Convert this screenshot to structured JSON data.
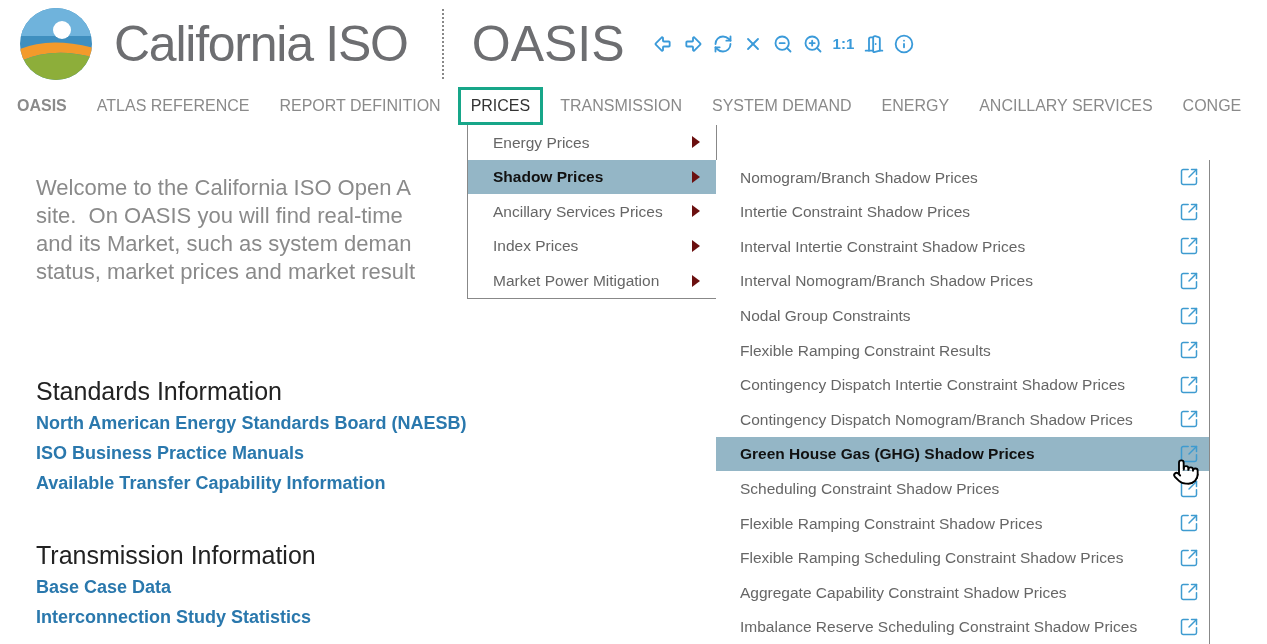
{
  "header": {
    "logo_text": "California ISO",
    "app_title": "OASIS",
    "toolbar": [
      {
        "kind": "back"
      },
      {
        "kind": "forward"
      },
      {
        "kind": "refresh"
      },
      {
        "kind": "close"
      },
      {
        "kind": "zoom_out"
      },
      {
        "kind": "zoom_in"
      },
      {
        "kind": "text",
        "label": "1:1"
      },
      {
        "kind": "exit"
      },
      {
        "kind": "info"
      }
    ]
  },
  "nav": [
    {
      "label": "OASIS",
      "selected": false,
      "bold": true
    },
    {
      "label": "ATLAS REFERENCE",
      "selected": false,
      "bold": false
    },
    {
      "label": "REPORT DEFINITION",
      "selected": false,
      "bold": false
    },
    {
      "label": "PRICES",
      "selected": true,
      "bold": false
    },
    {
      "label": "TRANSMISSION",
      "selected": false,
      "bold": false
    },
    {
      "label": "SYSTEM DEMAND",
      "selected": false,
      "bold": false
    },
    {
      "label": "ENERGY",
      "selected": false,
      "bold": false
    },
    {
      "label": "ANCILLARY SERVICES",
      "selected": false,
      "bold": false
    },
    {
      "label": "CONGE",
      "selected": false,
      "bold": false
    }
  ],
  "welcome_lines": [
    "Welcome to the California ISO Open A",
    "site.  On OASIS you will find real-time",
    "and its Market, such as system deman",
    "status, market prices and market result"
  ],
  "sections": [
    {
      "heading": "Standards Information",
      "links": [
        "North American Energy Standards Board (NAESB)",
        "ISO Business Practice Manuals",
        "Available Transfer Capability Information"
      ]
    },
    {
      "heading": "Transmission Information",
      "links": [
        "Base Case Data",
        "Interconnection Study Statistics"
      ]
    }
  ],
  "menu": [
    {
      "label": "Energy Prices",
      "selected": false
    },
    {
      "label": "Shadow Prices",
      "selected": true
    },
    {
      "label": "Ancillary Services Prices",
      "selected": false
    },
    {
      "label": "Index Prices",
      "selected": false
    },
    {
      "label": "Market Power Mitigation",
      "selected": false
    }
  ],
  "submenu": [
    {
      "label": "Nomogram/Branch Shadow Prices",
      "selected": false
    },
    {
      "label": "Intertie Constraint Shadow Prices",
      "selected": false
    },
    {
      "label": "Interval Intertie Constraint Shadow Prices",
      "selected": false
    },
    {
      "label": "Interval Nomogram/Branch Shadow Prices",
      "selected": false
    },
    {
      "label": "Nodal Group Constraints",
      "selected": false
    },
    {
      "label": "Flexible Ramping Constraint Results",
      "selected": false
    },
    {
      "label": "Contingency Dispatch Intertie Constraint Shadow Prices",
      "selected": false
    },
    {
      "label": "Contingency Dispatch Nomogram/Branch Shadow Prices",
      "selected": false
    },
    {
      "label": "Green House Gas (GHG) Shadow Prices",
      "selected": true
    },
    {
      "label": "Scheduling Constraint Shadow Prices",
      "selected": false
    },
    {
      "label": "Flexible Ramping Constraint Shadow Prices",
      "selected": false
    },
    {
      "label": "Flexible Ramping Scheduling Constraint Shadow Prices",
      "selected": false
    },
    {
      "label": "Aggregate Capability Constraint Shadow Prices",
      "selected": false
    },
    {
      "label": "Imbalance Reserve Scheduling Constraint Shadow Prices",
      "selected": false
    }
  ]
}
